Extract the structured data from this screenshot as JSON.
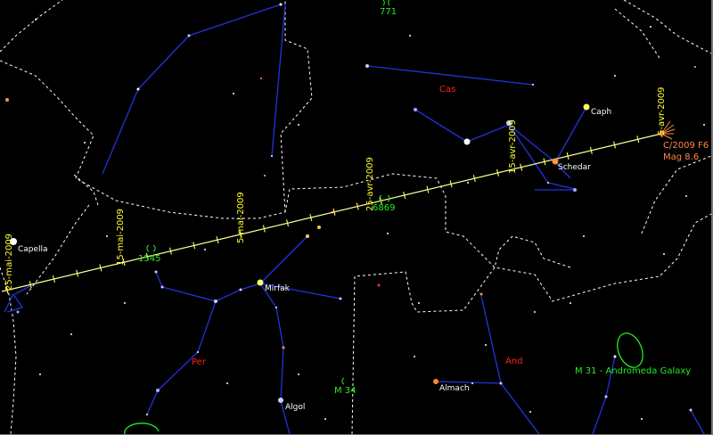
{
  "colors": {
    "background": "#000000",
    "constellation_lines": "#2233dd",
    "boundaries": "#ffffff",
    "comet_path": "#ffff99",
    "constellation_names": "#ff2020",
    "deep_sky": "#22ee22",
    "comet": "#ff8844",
    "date_labels": "#ffff33",
    "star_labels": "#ffffff"
  },
  "comet": {
    "designation": "C/2009 F6",
    "magnitude": "Mag 8.6"
  },
  "path_dates": [
    "5-avr-2009",
    "15-avr-2009",
    "25-avr-2009",
    "5-mai-2009",
    "15-mai-2009",
    "25-mai-2009"
  ],
  "constellations": [
    "Cas",
    "Per",
    "And"
  ],
  "stars": [
    "Caph",
    "Schedar",
    "Capella",
    "Mirfak",
    "Algol",
    "Almach"
  ],
  "deep_sky_objects": [
    "771",
    "6869",
    "1545",
    "M 34",
    "M 31 - Andromeda Galaxy"
  ],
  "icons": [
    "comet-icon",
    "galaxy-icon",
    "open-cluster-icon"
  ]
}
